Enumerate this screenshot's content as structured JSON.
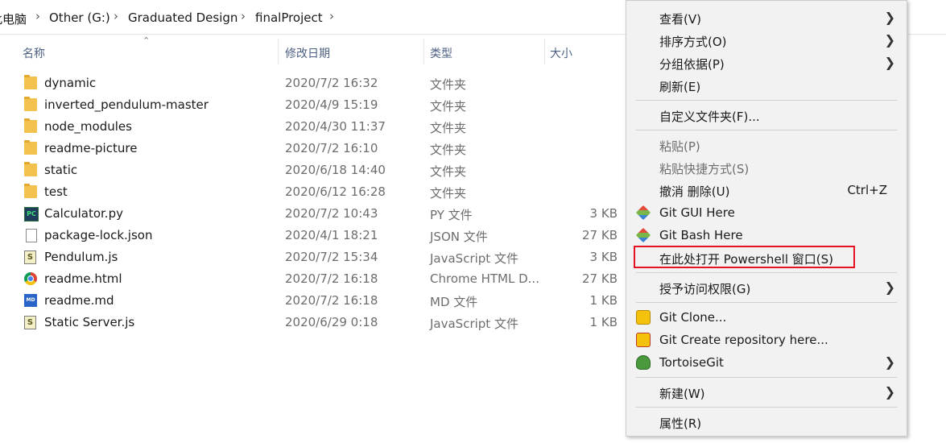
{
  "breadcrumb": [
    "此电脑",
    "Other (G:)",
    "Graduated Design",
    "finalProject"
  ],
  "columns": {
    "name": "名称",
    "date": "修改日期",
    "type": "类型",
    "size": "大小"
  },
  "files": [
    {
      "icon": "folder-icon",
      "name": "dynamic",
      "date": "2020/7/2 16:32",
      "type": "文件夹",
      "size": ""
    },
    {
      "icon": "folder-icon",
      "name": "inverted_pendulum-master",
      "date": "2020/4/9 15:19",
      "type": "文件夹",
      "size": ""
    },
    {
      "icon": "folder-icon",
      "name": "node_modules",
      "date": "2020/4/30 11:37",
      "type": "文件夹",
      "size": ""
    },
    {
      "icon": "folder-icon",
      "name": "readme-picture",
      "date": "2020/7/2 16:10",
      "type": "文件夹",
      "size": ""
    },
    {
      "icon": "folder-icon",
      "name": "static",
      "date": "2020/6/18 14:40",
      "type": "文件夹",
      "size": ""
    },
    {
      "icon": "folder-icon",
      "name": "test",
      "date": "2020/6/12 16:28",
      "type": "文件夹",
      "size": ""
    },
    {
      "icon": "pycharm-file-icon",
      "name": "Calculator.py",
      "date": "2020/7/2 10:43",
      "type": "PY 文件",
      "size": "3 KB"
    },
    {
      "icon": "document-icon",
      "name": "package-lock.json",
      "date": "2020/4/1 18:21",
      "type": "JSON 文件",
      "size": "27 KB"
    },
    {
      "icon": "javascript-file-icon",
      "name": "Pendulum.js",
      "date": "2020/7/2 15:34",
      "type": "JavaScript 文件",
      "size": "3 KB"
    },
    {
      "icon": "chrome-icon",
      "name": "readme.html",
      "date": "2020/7/2 16:18",
      "type": "Chrome HTML D...",
      "size": "27 KB"
    },
    {
      "icon": "markdown-file-icon",
      "name": "readme.md",
      "date": "2020/7/2 16:18",
      "type": "MD 文件",
      "size": "1 KB"
    },
    {
      "icon": "javascript-file-icon",
      "name": "Static Server.js",
      "date": "2020/6/29 0:18",
      "type": "JavaScript 文件",
      "size": "1 KB"
    }
  ],
  "context_menu": {
    "view": "查看(V)",
    "sort_by": "排序方式(O)",
    "group_by": "分组依据(P)",
    "refresh": "刷新(E)",
    "customize_folder": "自定义文件夹(F)...",
    "paste": "粘贴(P)",
    "paste_shortcut": "粘贴快捷方式(S)",
    "undo_delete": "撤消 删除(U)",
    "undo_shortcut": "Ctrl+Z",
    "git_gui": "Git GUI Here",
    "git_bash": "Git Bash Here",
    "powershell": "在此处打开 Powershell 窗口(S)",
    "give_access": "授予访问权限(G)",
    "git_clone": "Git Clone...",
    "git_create": "Git Create repository here...",
    "tortoisegit": "TortoiseGit",
    "new": "新建(W)",
    "properties": "属性(R)"
  },
  "highlight_color": "#e81123"
}
